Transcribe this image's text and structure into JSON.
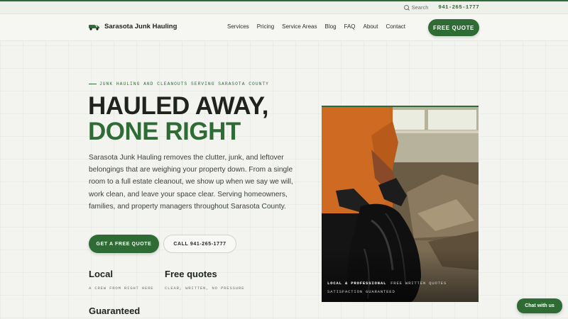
{
  "utility": {
    "search_label": "Search",
    "phone": "941-265-1777"
  },
  "brand": {
    "name": "Sarasota Junk Hauling",
    "logo_icon": "truck-icon"
  },
  "nav": {
    "items": [
      "Services",
      "Pricing",
      "Service Areas",
      "Blog",
      "FAQ",
      "About",
      "Contact"
    ],
    "cta": "FREE QUOTE"
  },
  "hero": {
    "eyebrow": "JUNK HAULING AND CLEANOUTS SERVING SARASOTA COUNTY",
    "headline_line1": "HAULED AWAY,",
    "headline_line2": "DONE RIGHT",
    "lead": "Sarasota Junk Hauling removes the clutter, junk, and leftover belongings that are weighing your property down. From a single room to a full estate cleanout, we show up when we say we will, work clean, and leave your space clear. Serving homeowners, families, and property managers throughout Sarasota County.",
    "primary_button": "GET A FREE QUOTE",
    "secondary_button": "CALL 941-265-1777",
    "features": [
      {
        "title": "Local",
        "subtitle": "A CREW FROM RIGHT HERE"
      },
      {
        "title": "Free quotes",
        "subtitle": "CLEAR, WRITTEN, NO PRESSURE"
      },
      {
        "title": "Guaranteed",
        "subtitle": ""
      }
    ],
    "photo_caption": {
      "item1": "LOCAL & PROFESSIONAL",
      "item2": "FREE WRITTEN QUOTES",
      "item3": "SATISFACTION GUARANTEED"
    }
  },
  "chat": {
    "label": "Chat with us"
  },
  "colors": {
    "brand_green": "#2f6b34",
    "text_dark": "#1f2320",
    "background": "#f3f4f0"
  }
}
